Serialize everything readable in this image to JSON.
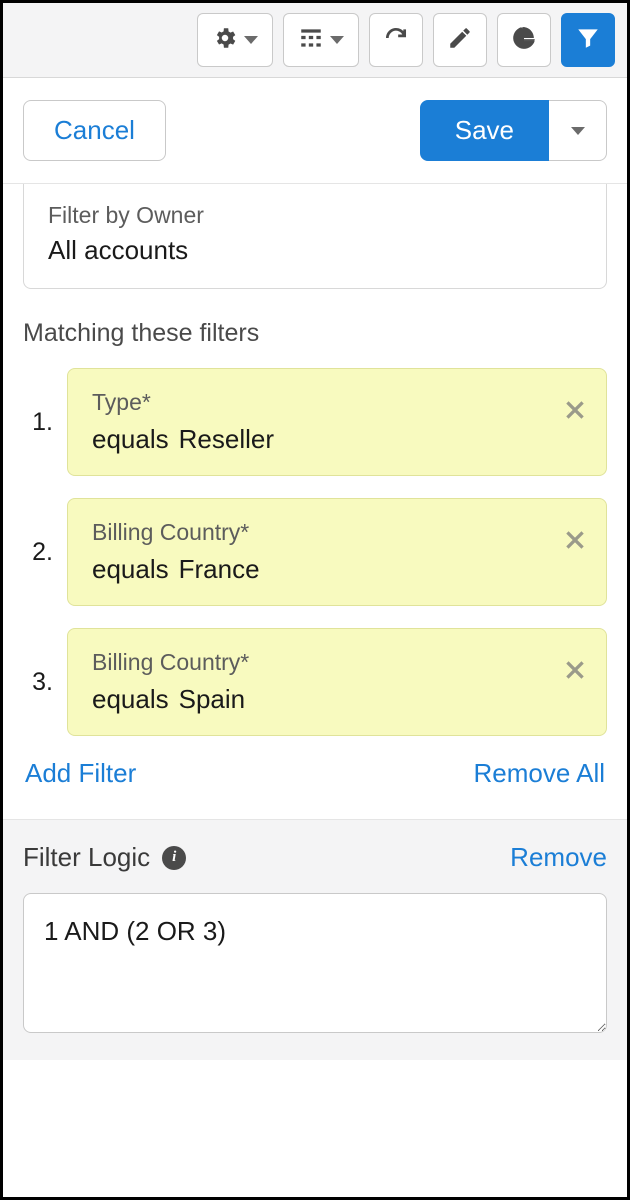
{
  "actionBar": {
    "cancel": "Cancel",
    "save": "Save"
  },
  "owner": {
    "label": "Filter by Owner",
    "value": "All accounts"
  },
  "filtersHeading": "Matching these filters",
  "filters": [
    {
      "num": "1.",
      "field": "Type*",
      "operator": "equals",
      "value": "Reseller"
    },
    {
      "num": "2.",
      "field": "Billing Country*",
      "operator": "equals",
      "value": "France"
    },
    {
      "num": "3.",
      "field": "Billing Country*",
      "operator": "equals",
      "value": "Spain"
    }
  ],
  "links": {
    "addFilter": "Add Filter",
    "removeAll": "Remove All",
    "remove": "Remove"
  },
  "logic": {
    "title": "Filter Logic",
    "value": "1 AND (2 OR 3)"
  }
}
